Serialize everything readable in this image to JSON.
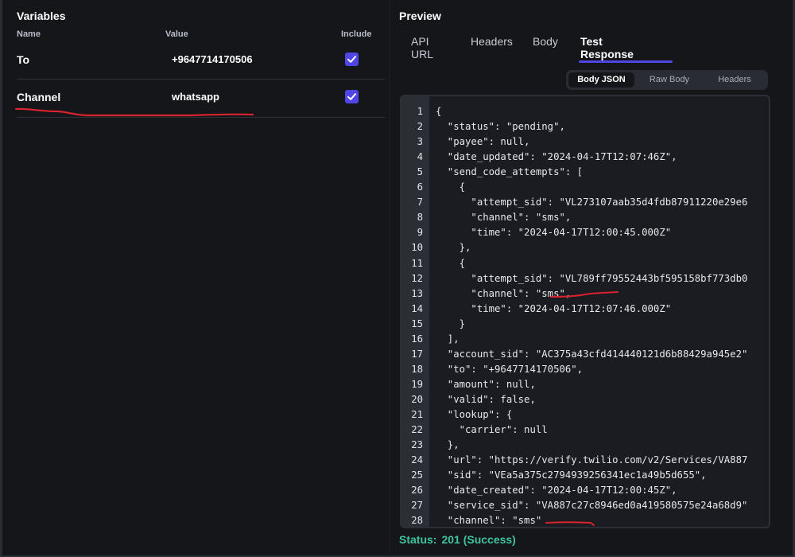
{
  "variables": {
    "title": "Variables",
    "headers": {
      "name": "Name",
      "value": "Value",
      "include": "Include"
    },
    "rows": [
      {
        "name": "To",
        "value": "+9647714170506",
        "included": true
      },
      {
        "name": "Channel",
        "value": "whatsapp",
        "included": true
      }
    ]
  },
  "preview": {
    "title": "Preview",
    "tabs": [
      {
        "label": "API URL",
        "active": false
      },
      {
        "label": "Headers",
        "active": false
      },
      {
        "label": "Body",
        "active": false
      },
      {
        "label": "Test Response",
        "active": true
      }
    ],
    "subtabs": [
      {
        "label": "Body JSON",
        "active": true
      },
      {
        "label": "Raw Body",
        "active": false
      },
      {
        "label": "Headers",
        "active": false
      }
    ],
    "code_lines": [
      "{",
      "  \"status\": \"pending\",",
      "  \"payee\": null,",
      "  \"date_updated\": \"2024-04-17T12:07:46Z\",",
      "  \"send_code_attempts\": [",
      "    {",
      "      \"attempt_sid\": \"VL273107aab35d4fdb87911220e29e6",
      "      \"channel\": \"sms\",",
      "      \"time\": \"2024-04-17T12:00:45.000Z\"",
      "    },",
      "    {",
      "      \"attempt_sid\": \"VL789ff79552443bf595158bf773db0",
      "      \"channel\": \"sms\",",
      "      \"time\": \"2024-04-17T12:07:46.000Z\"",
      "    }",
      "  ],",
      "  \"account_sid\": \"AC375a43cfd414440121d6b88429a945e2\"",
      "  \"to\": \"+9647714170506\",",
      "  \"amount\": null,",
      "  \"valid\": false,",
      "  \"lookup\": {",
      "    \"carrier\": null",
      "  },",
      "  \"url\": \"https://verify.twilio.com/v2/Services/VA887",
      "  \"sid\": \"VEa5a375c2794939256341ec1a49b5d655\",",
      "  \"date_created\": \"2024-04-17T12:00:45Z\",",
      "  \"service_sid\": \"VA887c27c8946ed0a419580575e24a68d9\"",
      "  \"channel\": \"sms\""
    ],
    "status_label": "Status:",
    "status_value": "201 (Success)"
  },
  "colors": {
    "accent": "#4f46e5",
    "status": "#3fc4a1",
    "annotation": "#d9232e"
  }
}
